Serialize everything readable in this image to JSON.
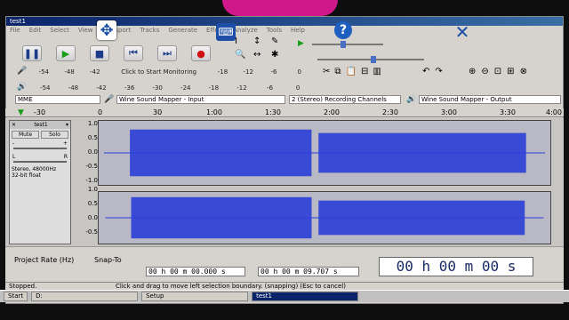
{
  "window": {
    "title": "test1"
  },
  "menu": [
    "File",
    "Edit",
    "Select",
    "View",
    "Transport",
    "Tracks",
    "Generate",
    "Effect",
    "Analyze",
    "Tools",
    "Help"
  ],
  "meters": {
    "record_labels": [
      "-54",
      "-48",
      "-42",
      "Click to Start Monitoring",
      "-18",
      "-12",
      "-6",
      "0"
    ],
    "play_labels": [
      "-54",
      "-48",
      "-42",
      "-36",
      "-30",
      "-24",
      "-18",
      "-12",
      "-6",
      "0"
    ]
  },
  "devices": {
    "host": "MME",
    "input": "Wine Sound Mapper - Input",
    "channels": "2 (Stereo) Recording Channels",
    "output": "Wine Sound Mapper - Output"
  },
  "ruler": [
    "-30",
    "0",
    "30",
    "1:00",
    "1:30",
    "2:00",
    "2:30",
    "3:00",
    "3:30",
    "4:00"
  ],
  "track": {
    "name": "test1",
    "mute": "Mute",
    "solo": "Solo",
    "gain_minus": "-",
    "gain_plus": "+",
    "pan_left": "L",
    "pan_right": "R",
    "info1": "Stereo, 48000Hz",
    "info2": "32-bit float",
    "yaxis": [
      "1.0",
      "0.5",
      "0.0",
      "-0.5",
      "-1.0"
    ]
  },
  "bottom": {
    "project_rate_label": "Project Rate (Hz)",
    "snap_label": "Snap-To",
    "sel_start": "00 h 00 m 00.000 s",
    "sel_end": "00 h 00 m 09.707 s",
    "big_time": "00 h 00 m 00 s"
  },
  "status": {
    "left": "Stopped.",
    "message": "Click and drag to move left selection boundary. (snapping) (Esc to cancel)"
  },
  "taskbar": {
    "start": "Start",
    "drive": "D:",
    "setup": "Setup",
    "active": "test1"
  },
  "colors": {
    "waveform": "#2b3fd6",
    "wave_bg": "#b9b9c6",
    "accent": "#1e4fa8"
  }
}
